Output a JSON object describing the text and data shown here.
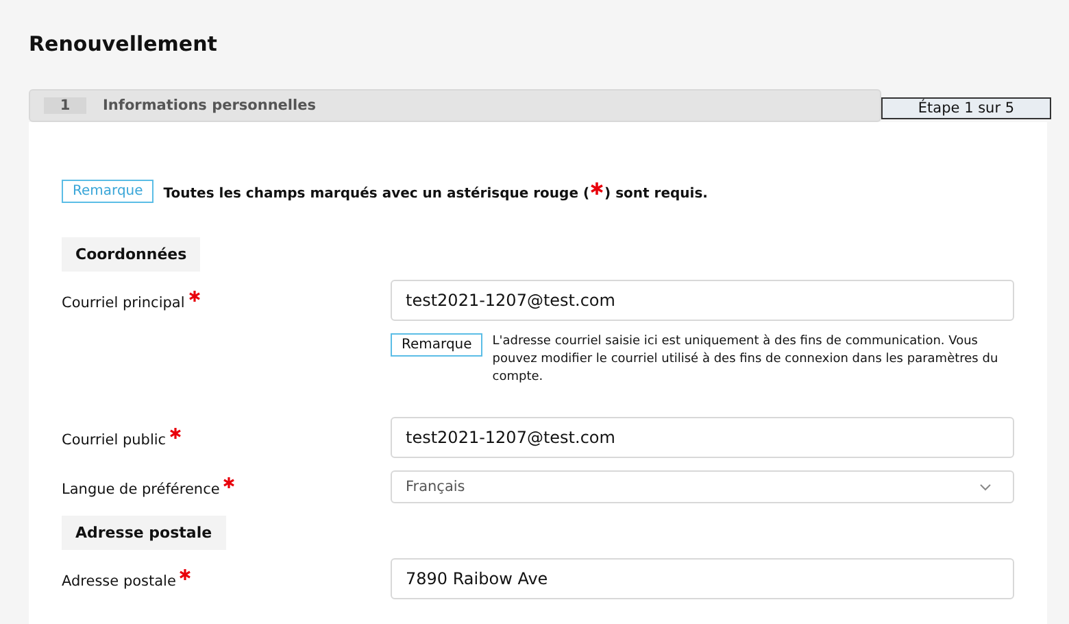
{
  "page_title": "Renouvellement",
  "step_tab": {
    "number": "1",
    "label": "Informations personnelles",
    "selected": true
  },
  "step_indicator": "Étape 1 sur 5",
  "required_note": {
    "badge": "Remarque",
    "text_before": "Toutes les champs marqués avec un astérisque rouge (",
    "text_after": ") sont requis."
  },
  "items": [
    {
      "kind": "section",
      "label": "Coordonnées"
    },
    {
      "kind": "field",
      "label": "Courriel principal",
      "required": true,
      "value": "test2021-1207@test.com"
    },
    {
      "kind": "note",
      "badge": "Remarque",
      "text": "L'adresse courriel saisie ici est uniquement à des fins de communication. Vous pouvez modifier le courriel utilisé à des fins de connexion dans les paramètres du compte."
    },
    {
      "kind": "field",
      "label": "Courriel public",
      "required": true,
      "value": "test2021-1207@test.com"
    },
    {
      "kind": "select",
      "label": "Langue de préférence",
      "required": true,
      "value": "Français"
    },
    {
      "kind": "section",
      "label": "Adresse postale"
    },
    {
      "kind": "field",
      "label": "Adresse postale",
      "required": true,
      "value": "7890 Raibow Ave"
    }
  ]
}
